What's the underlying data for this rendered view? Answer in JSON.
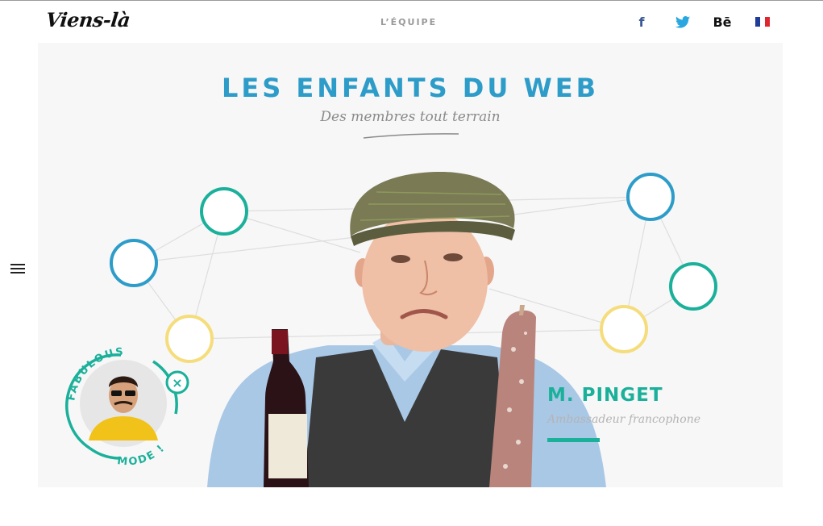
{
  "header": {
    "logo": "Viens-là",
    "nav_equipe": "L’ÉQUIPE",
    "social": {
      "facebook_glyph": "f",
      "behance_glyph": "Bē",
      "facebook_icon": "facebook-icon",
      "twitter_icon": "twitter-icon",
      "behance_icon": "behance-icon",
      "flag_icon": "french-flag-icon"
    }
  },
  "hero": {
    "title": "LES ENFANTS DU WEB",
    "subtitle": "Des membres tout terrain",
    "member": {
      "name": "M. PINGET",
      "role": "Ambassadeur francophone"
    }
  },
  "badge": {
    "text_top": "FABULOUS",
    "text_bottom": "MODE !",
    "close_glyph": "×"
  },
  "menu": {
    "icon": "hamburger-menu-icon"
  },
  "colors": {
    "blue": "#2e9cc9",
    "teal": "#1ab09a",
    "yellow": "#f5dd7c",
    "grey_text": "#9a9a9a",
    "hero_bg": "#f7f7f7"
  }
}
